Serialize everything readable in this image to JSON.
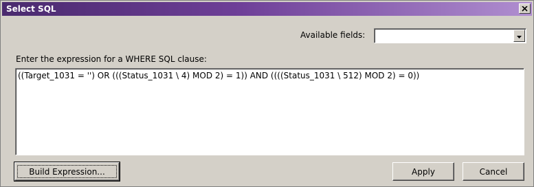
{
  "window": {
    "title": "Select SQL"
  },
  "fields": {
    "label": "Available fields:",
    "value": ""
  },
  "expression": {
    "label": "Enter the expression for a WHERE SQL clause:",
    "value": "((Target_1031 = '') OR (((Status_1031 \\ 4) MOD 2) = 1)) AND ((((Status_1031 \\ 512) MOD 2) = 0))"
  },
  "buttons": {
    "build": "Build Expression...",
    "apply": "Apply",
    "cancel": "Cancel"
  },
  "icons": {
    "close": "close-icon",
    "dropdown": "chevron-down-icon"
  }
}
